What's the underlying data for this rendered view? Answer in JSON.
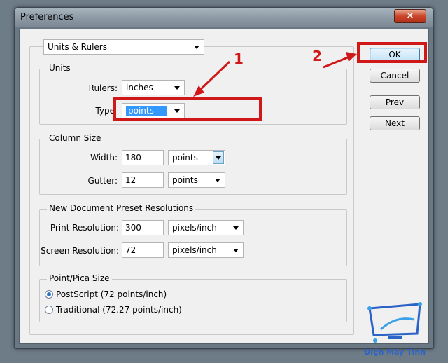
{
  "window": {
    "title": "Preferences",
    "close_label": "×"
  },
  "section_select": {
    "value": "Units & Rulers"
  },
  "units": {
    "legend": "Units",
    "rulers_label": "Rulers:",
    "rulers_value": "inches",
    "type_label": "Type",
    "type_value": "points"
  },
  "column_size": {
    "legend": "Column Size",
    "width_label": "Width:",
    "width_value": "180",
    "width_unit": "points",
    "gutter_label": "Gutter:",
    "gutter_value": "12",
    "gutter_unit": "points"
  },
  "resolutions": {
    "legend": "New Document Preset Resolutions",
    "print_label": "Print Resolution:",
    "print_value": "300",
    "print_unit": "pixels/inch",
    "screen_label": "Screen Resolution:",
    "screen_value": "72",
    "screen_unit": "pixels/inch"
  },
  "pica": {
    "legend": "Point/Pica Size",
    "postscript_label": "PostScript (72 points/inch)",
    "traditional_label": "Traditional (72.27 points/inch)",
    "selected": "postscript"
  },
  "buttons": {
    "ok": "OK",
    "cancel": "Cancel",
    "prev": "Prev",
    "next": "Next"
  },
  "annotations": {
    "one": "1",
    "two": "2"
  },
  "watermark": {
    "text": "Điện Máy Tính"
  },
  "colors": {
    "annotation_red": "#d01818",
    "selection_blue": "#3399ff",
    "watermark_blue": "#2b63c9"
  }
}
